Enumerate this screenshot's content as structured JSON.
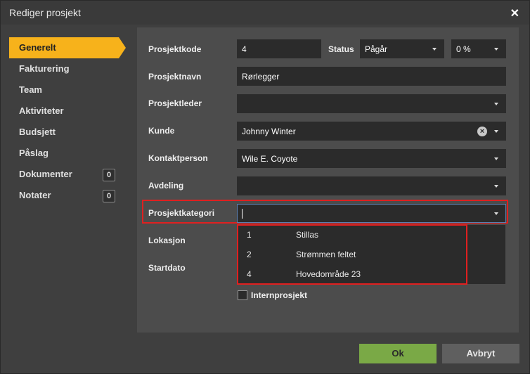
{
  "dialog": {
    "title": "Rediger prosjekt",
    "close_glyph": "✕"
  },
  "nav": {
    "items": [
      {
        "label": "Generelt",
        "active": true
      },
      {
        "label": "Fakturering"
      },
      {
        "label": "Team"
      },
      {
        "label": "Aktiviteter"
      },
      {
        "label": "Budsjett"
      },
      {
        "label": "Påslag"
      },
      {
        "label": "Dokumenter",
        "badge": "0"
      },
      {
        "label": "Notater",
        "badge": "0"
      }
    ]
  },
  "form": {
    "prosjektkode": {
      "label": "Prosjektkode",
      "value": "4"
    },
    "status": {
      "label": "Status",
      "value": "Pågår"
    },
    "percent": {
      "value": "0 %"
    },
    "prosjektnavn": {
      "label": "Prosjektnavn",
      "value": "Rørlegger"
    },
    "prosjektleder": {
      "label": "Prosjektleder",
      "value": ""
    },
    "kunde": {
      "label": "Kunde",
      "value": "Johnny Winter"
    },
    "kontaktperson": {
      "label": "Kontaktperson",
      "value": "Wile E. Coyote"
    },
    "avdeling": {
      "label": "Avdeling",
      "value": ""
    },
    "prosjektkategori": {
      "label": "Prosjektkategori",
      "value": ""
    },
    "lokasjon": {
      "label": "Lokasjon"
    },
    "startdato": {
      "label": "Startdato"
    },
    "internprosjekt": {
      "label": "Internprosjekt",
      "checked": false
    }
  },
  "category_dropdown": {
    "options": [
      {
        "num": "1",
        "name": "Stillas"
      },
      {
        "num": "2",
        "name": "Strømmen feltet"
      },
      {
        "num": "4",
        "name": "Hovedområde 23"
      }
    ]
  },
  "buttons": {
    "ok": "Ok",
    "cancel": "Avbryt"
  },
  "colors": {
    "accent": "#f7b21b",
    "ok": "#7aa946",
    "highlight": "#e02020"
  }
}
